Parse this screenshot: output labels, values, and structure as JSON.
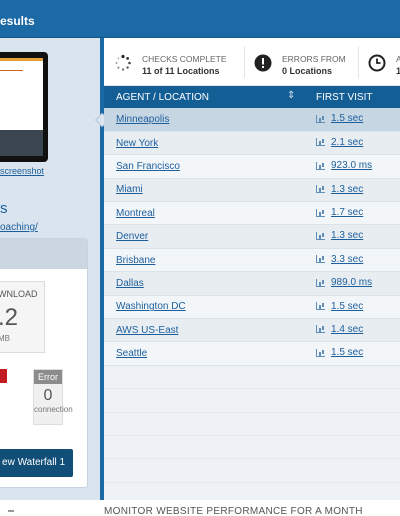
{
  "header": {
    "title": "esults"
  },
  "left_panel": {
    "screenshot_link": "screenshot",
    "site_initial": "s",
    "site_url": "oaching/",
    "download": {
      "label": "WNLOAD",
      "value": ".2",
      "unit": "MB"
    },
    "error": {
      "label": "Error",
      "value": "0",
      "sub": "connection"
    },
    "waterfall_button": "ew Waterfall 1"
  },
  "stats": {
    "checks": {
      "label": "CHECKS COMPLETE",
      "value": "11 of 11 Locations"
    },
    "errors": {
      "label": "ERRORS FROM",
      "value": "0 Locations"
    },
    "avg": {
      "label": "AV",
      "value": "1."
    }
  },
  "table": {
    "col_location": "AGENT / LOCATION",
    "col_first_visit": "FIRST VISIT",
    "rows": [
      {
        "location": "Minneapolis",
        "first_visit": "1.5 sec"
      },
      {
        "location": "New York",
        "first_visit": "2.1 sec"
      },
      {
        "location": "San Francisco",
        "first_visit": "923.0 ms"
      },
      {
        "location": "Miami",
        "first_visit": "1.3 sec"
      },
      {
        "location": "Montreal",
        "first_visit": "1.7 sec"
      },
      {
        "location": "Denver",
        "first_visit": "1.3 sec"
      },
      {
        "location": "Brisbane",
        "first_visit": "3.3 sec"
      },
      {
        "location": "Dallas",
        "first_visit": "989.0 ms"
      },
      {
        "location": "Washington DC",
        "first_visit": "1.5 sec"
      },
      {
        "location": "AWS US-East",
        "first_visit": "1.4 sec"
      },
      {
        "location": "Seattle",
        "first_visit": "1.5 sec"
      }
    ]
  },
  "footer": {
    "promo": "MONITOR WEBSITE PERFORMANCE FOR A MONTH"
  }
}
